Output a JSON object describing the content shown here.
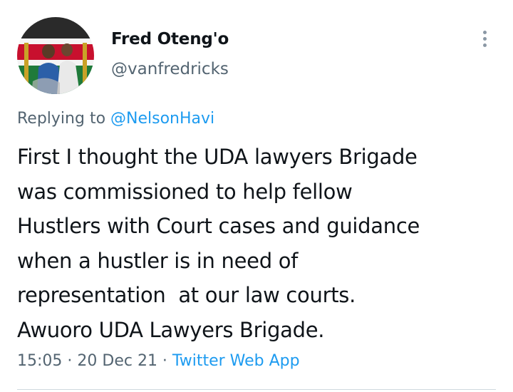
{
  "tweet": {
    "author": {
      "display_name": "Fred Oteng'o",
      "handle": "@vanfredricks",
      "avatar_description_icon": "profile-photo"
    },
    "more_icon": "vertical-ellipsis-icon",
    "replying_to_prefix": "Replying to ",
    "replying_to_handle": "@NelsonHavi",
    "text": "First I thought the UDA lawyers Brigade\nwas commissioned to help fellow\nHustlers with Court cases and guidance\nwhen a hustler is in need of\nrepresentation  at our law courts.\nAwuoro UDA Lawyers Brigade.",
    "time": "15:05",
    "separator": " · ",
    "date": "20 Dec 21",
    "source": "Twitter Web App"
  },
  "colors": {
    "primary_text": "#0f1419",
    "secondary_text": "#536471",
    "link": "#1d9bf0",
    "divider": "#cfd9de"
  }
}
